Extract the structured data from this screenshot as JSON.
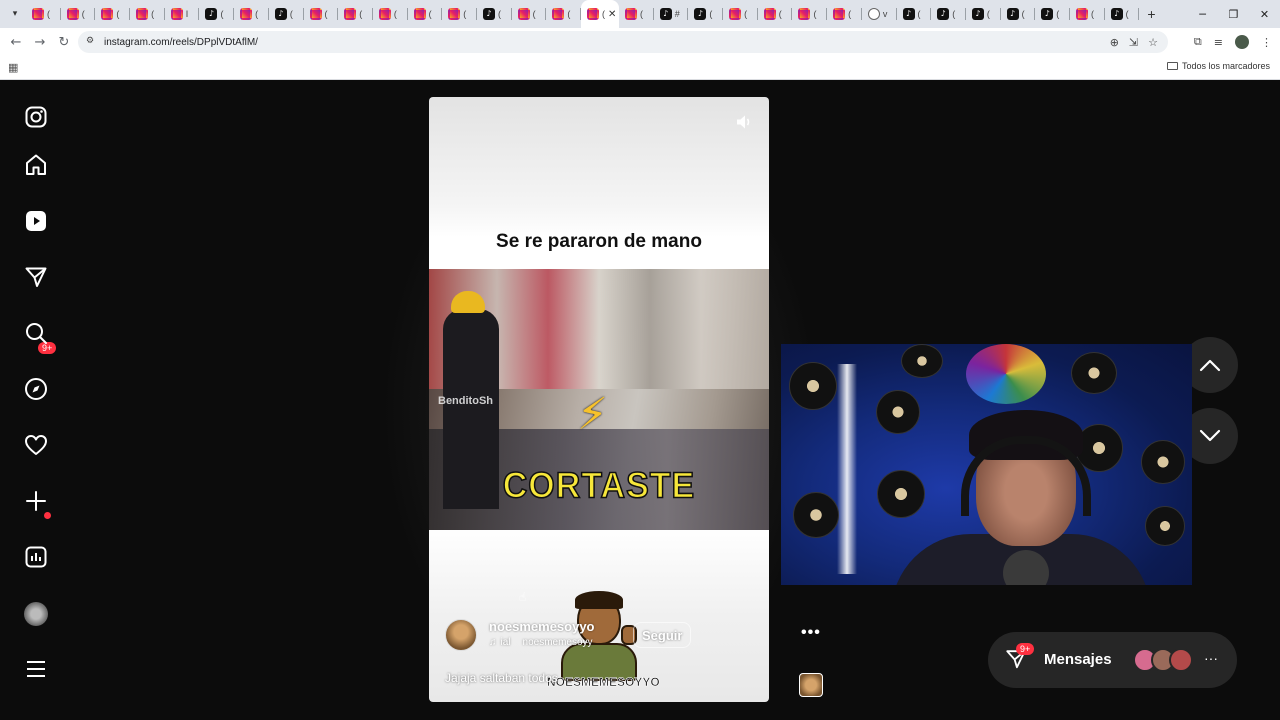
{
  "browser": {
    "tabs": [
      {
        "icon": "instagram-icon",
        "letter": "("
      },
      {
        "icon": "instagram-icon",
        "letter": "("
      },
      {
        "icon": "instagram-icon",
        "letter": "("
      },
      {
        "icon": "instagram-icon",
        "letter": "("
      },
      {
        "icon": "instagram-icon",
        "letter": "I"
      },
      {
        "icon": "tiktok-icon",
        "letter": "("
      },
      {
        "icon": "instagram-icon",
        "letter": "("
      },
      {
        "icon": "tiktok-icon",
        "letter": "("
      },
      {
        "icon": "instagram-icon",
        "letter": "("
      },
      {
        "icon": "instagram-icon",
        "letter": "("
      },
      {
        "icon": "instagram-icon",
        "letter": "("
      },
      {
        "icon": "instagram-icon",
        "letter": "("
      },
      {
        "icon": "instagram-icon",
        "letter": "("
      },
      {
        "icon": "tiktok-icon",
        "letter": "("
      },
      {
        "icon": "instagram-icon",
        "letter": "("
      },
      {
        "icon": "instagram-icon",
        "letter": "("
      },
      {
        "icon": "instagram-icon",
        "letter": "(",
        "active": true
      },
      {
        "icon": "instagram-icon",
        "letter": "("
      },
      {
        "icon": "tiktok-icon",
        "letter": "#"
      },
      {
        "icon": "tiktok-icon",
        "letter": "("
      },
      {
        "icon": "instagram-icon",
        "letter": "("
      },
      {
        "icon": "instagram-icon",
        "letter": "("
      },
      {
        "icon": "instagram-icon",
        "letter": "("
      },
      {
        "icon": "instagram-icon",
        "letter": "("
      },
      {
        "icon": "globe-icon",
        "letter": "v"
      },
      {
        "icon": "tiktok-icon",
        "letter": "("
      },
      {
        "icon": "tiktok-icon",
        "letter": "("
      },
      {
        "icon": "tiktok-icon",
        "letter": "("
      },
      {
        "icon": "tiktok-icon",
        "letter": "("
      },
      {
        "icon": "tiktok-icon",
        "letter": "("
      },
      {
        "icon": "instagram-icon",
        "letter": "("
      },
      {
        "icon": "tiktok-icon",
        "letter": "("
      }
    ],
    "url": "instagram.com/reels/DPplVDtAflM/",
    "bookmarks_all": "Todos los marcadores"
  },
  "sidebar": {
    "notifications_badge": "9+"
  },
  "reel": {
    "title_text": "Se re pararon de mano",
    "video_watermark": "BenditoSh",
    "video_overlay_text": "CORTASTE",
    "owner": "noesmemesoyyo",
    "audio_prefix": "ial",
    "audio_owner": "noesmemesoyy",
    "follow_label": "Seguir",
    "caption": "Jajaja saltaban todos",
    "sticker_label": "NOESMEMESOYYO"
  },
  "messages": {
    "badge": "9+",
    "label": "Mensajes"
  },
  "colors": {
    "accent_red": "#ff3040",
    "background": "#0c0c0c",
    "panel": "#262626"
  }
}
